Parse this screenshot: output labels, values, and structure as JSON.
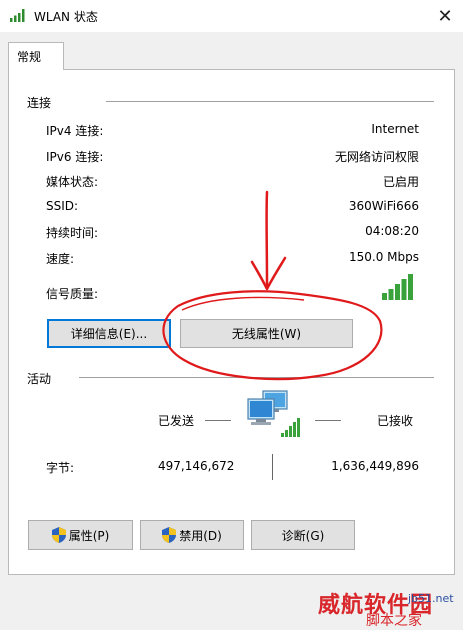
{
  "window": {
    "title": "WLAN 状态",
    "close_glyph": "✕",
    "title_icon": "wifi-signal-icon"
  },
  "tabs": [
    {
      "label": "常规",
      "selected": true
    }
  ],
  "connection": {
    "title": "连接",
    "rows": [
      {
        "label": "IPv4 连接:",
        "value": "Internet"
      },
      {
        "label": "IPv6 连接:",
        "value": "无网络访问权限"
      },
      {
        "label": "媒体状态:",
        "value": "已启用"
      },
      {
        "label": "SSID:",
        "value": "360WiFi666"
      },
      {
        "label": "持续时间:",
        "value": "04:08:20"
      },
      {
        "label": "速度:",
        "value": "150.0 Mbps"
      },
      {
        "label": "信号质量:",
        "value": ""
      }
    ],
    "signal_quality_bars": 5,
    "details_button": "详细信息(E)...",
    "wireless_properties_button": "无线属性(W)"
  },
  "activity": {
    "title": "活动",
    "sent_label": "已发送",
    "received_label": "已接收",
    "bytes_label": "字节:",
    "bytes_sent": "497,146,672",
    "bytes_received": "1,636,449,896",
    "icon": "network-computers-icon"
  },
  "buttons": {
    "properties": "属性(P)",
    "disable": "禁用(D)",
    "diagnose": "诊断(G)"
  },
  "colors": {
    "accent": "#0078d7",
    "signal": "#3aa23a",
    "annotation": "#e0191b"
  },
  "watermark": {
    "brand": "威航软件园",
    "sub": "脚本之家",
    "url": "jb51.net"
  }
}
